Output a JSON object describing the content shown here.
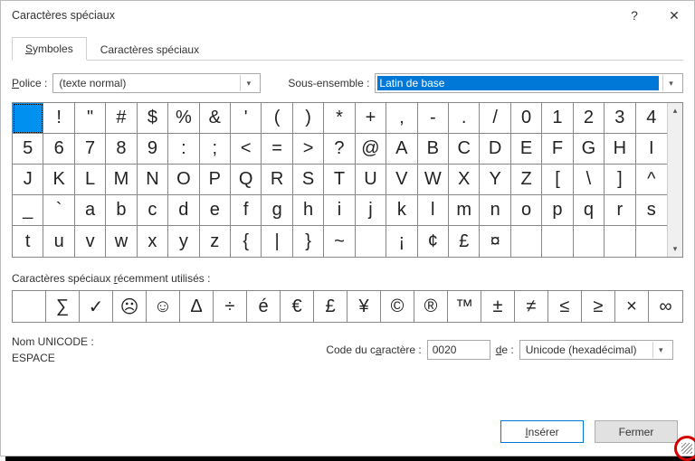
{
  "window": {
    "title": "Caractères spéciaux"
  },
  "tabs": {
    "symbols": "Symboles",
    "special": "Caractères spéciaux"
  },
  "font": {
    "label_pre": "P",
    "label_rest": "olice :",
    "value": "(texte normal)"
  },
  "subset": {
    "label": "Sous-ensemble :",
    "value": "Latin de base"
  },
  "grid_chars": [
    " ",
    "!",
    "\"",
    "#",
    "$",
    "%",
    "&",
    "'",
    "(",
    ")",
    "*",
    "+",
    ",",
    "-",
    ".",
    "/",
    "0",
    "1",
    "2",
    "3",
    "4",
    "5",
    "6",
    "7",
    "8",
    "9",
    ":",
    ";",
    "<",
    "=",
    ">",
    "?",
    "@",
    "A",
    "B",
    "C",
    "D",
    "E",
    "F",
    "G",
    "H",
    "I",
    "J",
    "K",
    "L",
    "M",
    "N",
    "O",
    "P",
    "Q",
    "R",
    "S",
    "T",
    "U",
    "V",
    "W",
    "X",
    "Y",
    "Z",
    "[",
    "\\",
    "]",
    "^",
    "_",
    "`",
    "a",
    "b",
    "c",
    "d",
    "e",
    "f",
    "g",
    "h",
    "i",
    "j",
    "k",
    "l",
    "m",
    "n",
    "o",
    "p",
    "q",
    "r",
    "s",
    "t",
    "u",
    "v",
    "w",
    "x",
    "y",
    "z",
    "{",
    "|",
    "}",
    "~",
    " ",
    "¡",
    "¢",
    "£",
    "¤"
  ],
  "recent_label": "Caractères spéciaux récemment utilisés :",
  "recent_chars": [
    " ",
    "∑",
    "✓",
    "☹",
    "☺",
    "Δ",
    "÷",
    "é",
    "€",
    "£",
    "¥",
    "©",
    "®",
    "™",
    "±",
    "≠",
    "≤",
    "≥",
    "×",
    "∞"
  ],
  "unicode": {
    "label": "Nom UNICODE :",
    "name": "ESPACE"
  },
  "code": {
    "label": "Code du caractère :",
    "value": "0020"
  },
  "from": {
    "label": "de :",
    "value": "Unicode (hexadécimal)"
  },
  "buttons": {
    "insert": "Insérer",
    "close": "Fermer"
  }
}
